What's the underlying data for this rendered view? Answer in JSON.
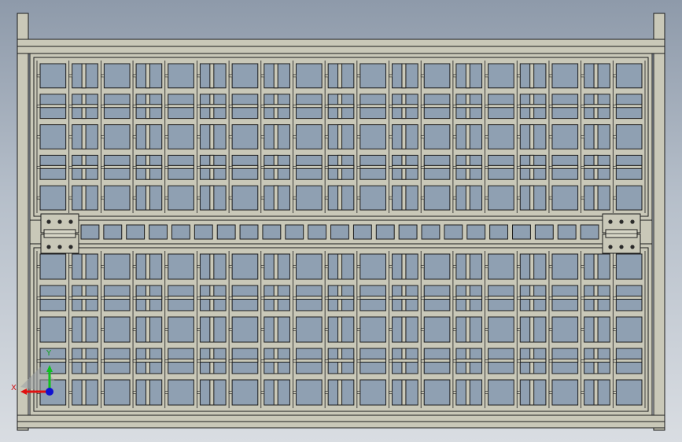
{
  "viewport": {
    "view_name": "Front",
    "background_gradient": [
      "#8e9aaa",
      "#b6bfca",
      "#d9dde2"
    ]
  },
  "model": {
    "part": "mesh-basket-with-hinged-lid",
    "face_color": "#c9c8b8",
    "edge_color": "#1c1c1c",
    "hole_color": "#8fa0b2",
    "upper_panel": {
      "rows": 5,
      "columns": 19
    },
    "lower_panel": {
      "rows": 5,
      "columns": 19
    },
    "hinge_strip": {
      "openings": 23
    },
    "hinges": 2
  },
  "triad": {
    "x_label": "X",
    "y_label": "Y",
    "x_color": "#e01010",
    "y_color": "#10c020",
    "z_color": "#1010d0"
  }
}
